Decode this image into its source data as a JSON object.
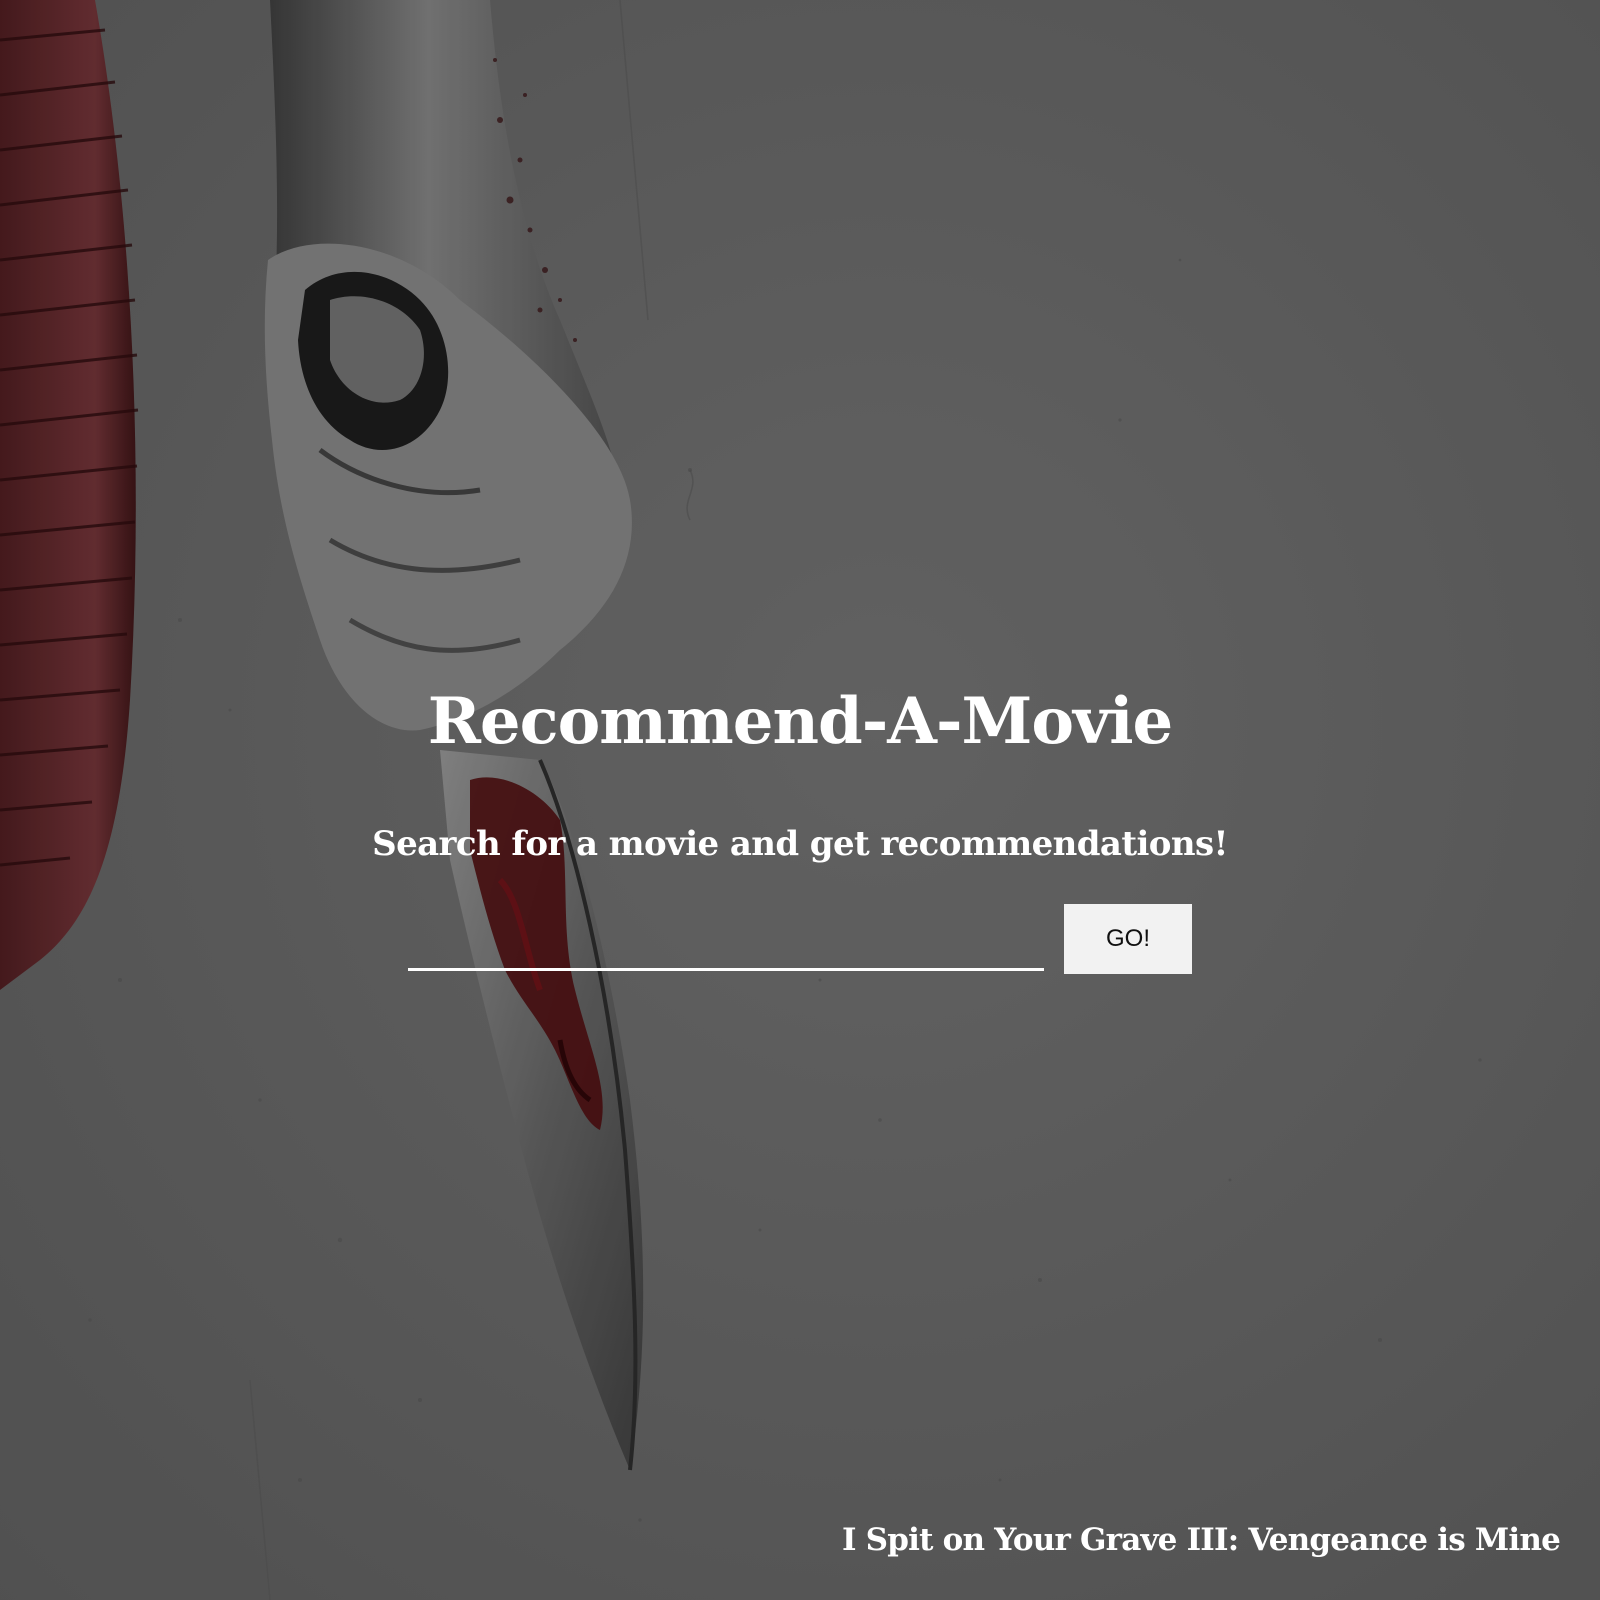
{
  "page": {
    "title": "Recommend-A-Movie",
    "subtitle": "Search for a movie and get recommendations!"
  },
  "search": {
    "value": "",
    "placeholder": "",
    "button_label": "GO!"
  },
  "background": {
    "featured_movie_title": "I Spit on Your Grave III: Vengeance is Mine"
  },
  "colors": {
    "overlay": "#606060",
    "text": "#ffffff",
    "button_bg": "#f2f2f2",
    "button_text": "#111111",
    "accent_blood": "#5a0f12"
  }
}
